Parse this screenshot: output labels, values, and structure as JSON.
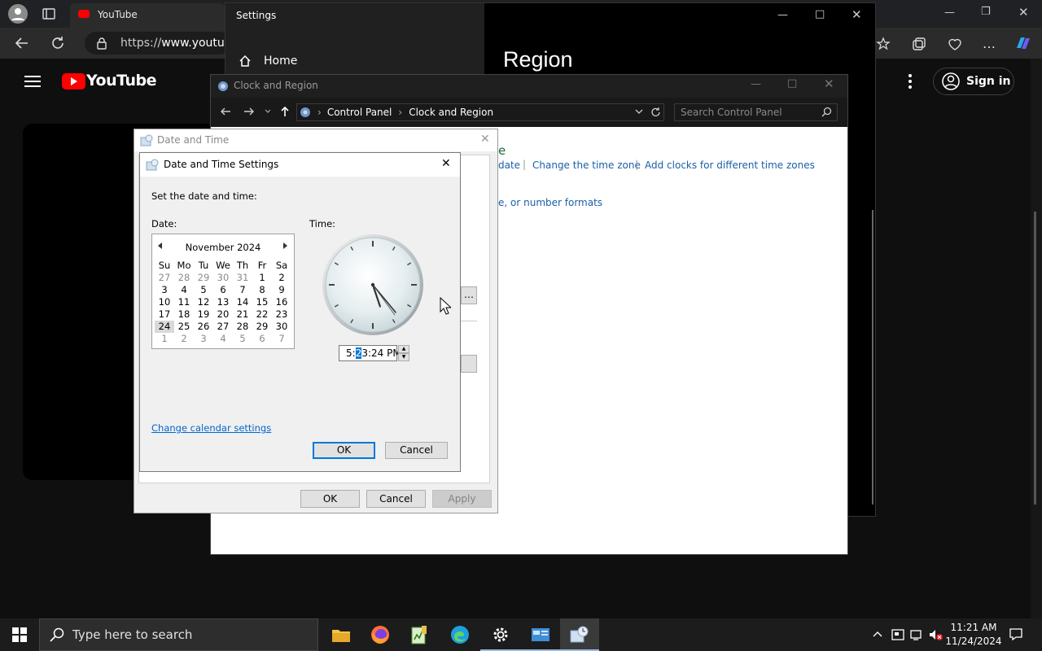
{
  "browser": {
    "tab_title": "YouTube",
    "address_scheme": "https://",
    "address_host": "www.youtube"
  },
  "youtube": {
    "logo_text": "YouTube",
    "signin_label": "Sign in"
  },
  "settings": {
    "window_title": "Settings",
    "home_label": "Home",
    "page_title": "Region"
  },
  "control_panel": {
    "window_title": "Clock and Region",
    "breadcrumb": [
      "Control Panel",
      "Clock and Region"
    ],
    "search_placeholder": "Search Control Panel",
    "link_date_fragment": "date",
    "link_change_timezone": "Change the time zone",
    "link_add_clocks": "Add clocks for different time zones",
    "link_formats_fragment": "e, or number formats",
    "heading_fragment": "e"
  },
  "date_time_dialog": {
    "title": "Date and Time",
    "ok_label": "OK",
    "cancel_label": "Cancel",
    "apply_label": "Apply"
  },
  "dts_dialog": {
    "title": "Date and Time Settings",
    "instruction": "Set the date and time:",
    "date_label": "Date:",
    "time_label": "Time:",
    "calendar_month": "November 2024",
    "weekdays": [
      "Su",
      "Mo",
      "Tu",
      "We",
      "Th",
      "Fr",
      "Sa"
    ],
    "weeks": [
      [
        "27",
        "28",
        "29",
        "30",
        "31",
        "1",
        "2"
      ],
      [
        "3",
        "4",
        "5",
        "6",
        "7",
        "8",
        "9"
      ],
      [
        "10",
        "11",
        "12",
        "13",
        "14",
        "15",
        "16"
      ],
      [
        "17",
        "18",
        "19",
        "20",
        "21",
        "22",
        "23"
      ],
      [
        "24",
        "25",
        "26",
        "27",
        "28",
        "29",
        "30"
      ],
      [
        "1",
        "2",
        "3",
        "4",
        "5",
        "6",
        "7"
      ]
    ],
    "selected_day": "24",
    "time_hour": "5:",
    "time_minute_selected": "2",
    "time_rest": "3:24 PM",
    "clock_time": {
      "hour": 5,
      "minute": 23,
      "second": 24
    },
    "change_calendar_link": "Change calendar settings",
    "ok_label": "OK",
    "cancel_label": "Cancel"
  },
  "taskbar": {
    "search_placeholder": "Type here to search",
    "time": "11:21 AM",
    "date": "11/24/2024"
  }
}
